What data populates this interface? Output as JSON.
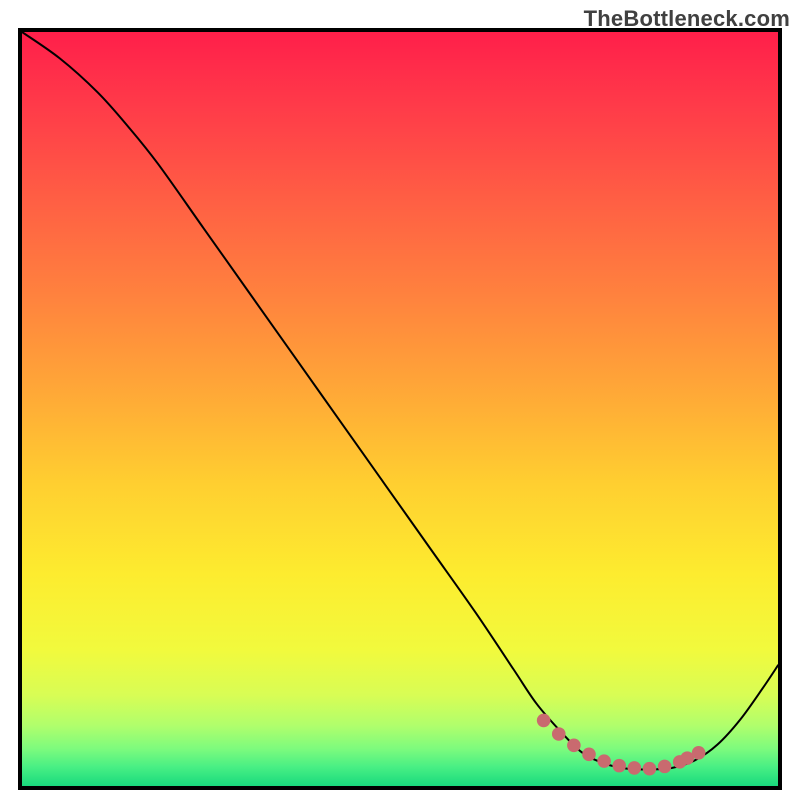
{
  "watermark": "TheBottleneck.com",
  "chart_data": {
    "type": "line",
    "title": "",
    "xlabel": "",
    "ylabel": "",
    "xlim": [
      0,
      100
    ],
    "ylim": [
      0,
      100
    ],
    "series": [
      {
        "name": "curve",
        "color": "#000000",
        "x": [
          0,
          5,
          10,
          14,
          18,
          24,
          30,
          36,
          42,
          48,
          54,
          60,
          65,
          68,
          71,
          74,
          77,
          80,
          83,
          86,
          89,
          92,
          95,
          98,
          100
        ],
        "y": [
          100,
          96.5,
          92,
          87.5,
          82.5,
          74,
          65.5,
          57,
          48.5,
          40,
          31.5,
          23,
          15.5,
          11,
          7.5,
          4.5,
          3,
          2.3,
          2.2,
          2.4,
          3.4,
          5.5,
          8.8,
          13,
          16
        ]
      },
      {
        "name": "highlight-dots",
        "color": "#c96a6f",
        "x": [
          69,
          71,
          73,
          75,
          77,
          79,
          81,
          83,
          85,
          87,
          88,
          89.5
        ],
        "y": [
          8.7,
          6.9,
          5.4,
          4.2,
          3.3,
          2.7,
          2.4,
          2.3,
          2.6,
          3.2,
          3.7,
          4.4
        ]
      }
    ],
    "background_gradient": {
      "type": "vertical",
      "stops": [
        {
          "pos": 0.0,
          "color": "#ff1f4a"
        },
        {
          "pos": 0.1,
          "color": "#ff3b49"
        },
        {
          "pos": 0.22,
          "color": "#ff5e44"
        },
        {
          "pos": 0.35,
          "color": "#ff823e"
        },
        {
          "pos": 0.48,
          "color": "#ffa937"
        },
        {
          "pos": 0.6,
          "color": "#ffcf30"
        },
        {
          "pos": 0.72,
          "color": "#fdec2f"
        },
        {
          "pos": 0.82,
          "color": "#f1fa3d"
        },
        {
          "pos": 0.88,
          "color": "#d8fd55"
        },
        {
          "pos": 0.92,
          "color": "#b0fe6c"
        },
        {
          "pos": 0.95,
          "color": "#7efb7d"
        },
        {
          "pos": 0.975,
          "color": "#48ef84"
        },
        {
          "pos": 1.0,
          "color": "#19da7d"
        }
      ]
    }
  }
}
